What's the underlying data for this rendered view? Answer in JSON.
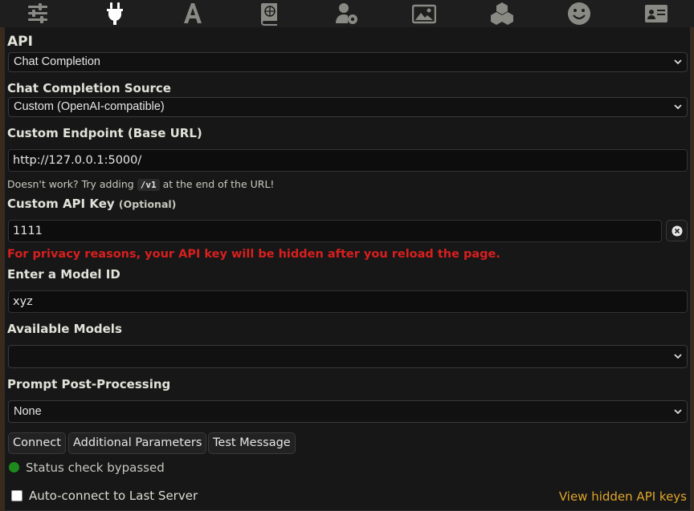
{
  "topbar": {
    "icons": [
      "sliders-icon",
      "plug-icon",
      "font-icon",
      "book-globe-icon",
      "user-gear-icon",
      "image-icon",
      "cubes-icon",
      "smile-icon",
      "id-card-icon"
    ]
  },
  "api": {
    "label": "API",
    "value": "Chat Completion"
  },
  "source": {
    "label": "Chat Completion Source",
    "value": "Custom (OpenAI-compatible)"
  },
  "endpoint": {
    "label": "Custom Endpoint (Base URL)",
    "value": "http://127.0.0.1:5000/",
    "hint_before": "Doesn't work? Try adding",
    "hint_code": "/v1",
    "hint_after": "at the end of the URL!"
  },
  "api_key": {
    "label": "Custom API Key",
    "optional": "(Optional)",
    "value": "1111",
    "warning": "For privacy reasons, your API key will be hidden after you reload the page."
  },
  "model_id": {
    "label": "Enter a Model ID",
    "value": "xyz"
  },
  "available_models": {
    "label": "Available Models",
    "value": ""
  },
  "post_processing": {
    "label": "Prompt Post-Processing",
    "value": "None"
  },
  "buttons": {
    "connect": "Connect",
    "additional": "Additional Parameters",
    "test": "Test Message"
  },
  "status": {
    "text": "Status check bypassed",
    "color": "#1e8a1e"
  },
  "auto_connect": {
    "label": "Auto-connect to Last Server",
    "checked": false
  },
  "hidden_keys_link": "View hidden API keys",
  "colors": {
    "warning": "#d81f1f",
    "link": "#e1a52a",
    "active_icon": "#ffffff",
    "icon": "#8a8a85"
  }
}
